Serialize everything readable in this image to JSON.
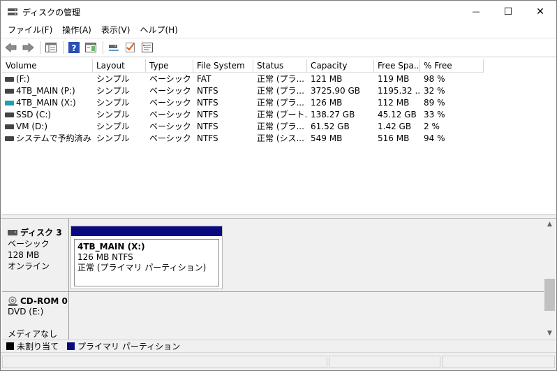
{
  "window": {
    "title": "ディスクの管理",
    "minimize_glyph": "—",
    "maximize_glyph": "☐",
    "close_glyph": "✕"
  },
  "menu": [
    "ファイル(F)",
    "操作(A)",
    "表示(V)",
    "ヘルプ(H)"
  ],
  "toolbar": {
    "icons": [
      "back-arrow-icon",
      "forward-arrow-icon",
      "list-view-icon",
      "help-icon",
      "properties-pane-icon",
      "connect-icon",
      "check-icon",
      "settings-pane-icon"
    ]
  },
  "volumes": {
    "columns": [
      "Volume",
      "Layout",
      "Type",
      "File System",
      "Status",
      "Capacity",
      "Free Spa...",
      "% Free"
    ],
    "rows": [
      {
        "volume": "(F:)",
        "layout": "シンプル",
        "type": "ベーシック",
        "fs": "FAT",
        "status": "正常 (プラ...",
        "capacity": "121 MB",
        "free": "119 MB",
        "pct": "98 %",
        "icon_color": "#444444"
      },
      {
        "volume": "4TB_MAIN (P:)",
        "layout": "シンプル",
        "type": "ベーシック",
        "fs": "NTFS",
        "status": "正常 (プラ...",
        "capacity": "3725.90 GB",
        "free": "1195.32 ...",
        "pct": "32 %",
        "icon_color": "#444444"
      },
      {
        "volume": "4TB_MAIN (X:)",
        "layout": "シンプル",
        "type": "ベーシック",
        "fs": "NTFS",
        "status": "正常 (プラ...",
        "capacity": "126 MB",
        "free": "112 MB",
        "pct": "89 %",
        "icon_color": "#1e9fb0"
      },
      {
        "volume": "SSD (C:)",
        "layout": "シンプル",
        "type": "ベーシック",
        "fs": "NTFS",
        "status": "正常 (ブート...",
        "capacity": "138.27 GB",
        "free": "45.12 GB",
        "pct": "33 %",
        "icon_color": "#444444"
      },
      {
        "volume": "VM (D:)",
        "layout": "シンプル",
        "type": "ベーシック",
        "fs": "NTFS",
        "status": "正常 (プラ...",
        "capacity": "61.52 GB",
        "free": "1.42 GB",
        "pct": "2 %",
        "icon_color": "#444444"
      },
      {
        "volume": "システムで予約済み",
        "layout": "シンプル",
        "type": "ベーシック",
        "fs": "NTFS",
        "status": "正常 (シス...",
        "capacity": "549 MB",
        "free": "516 MB",
        "pct": "94 %",
        "icon_color": "#444444"
      }
    ]
  },
  "disks": [
    {
      "name": "ディスク 3",
      "lines": [
        "ベーシック",
        "128 MB",
        "オンライン"
      ],
      "partition": {
        "title": "4TB_MAIN  (X:)",
        "size_fs": "126 MB NTFS",
        "status": "正常 (プライマリ パーティション)",
        "bar_color": "#0a0a80"
      }
    },
    {
      "name": "CD-ROM 0",
      "lines": [
        "DVD (E:)",
        "",
        "メディアなし"
      ]
    }
  ],
  "legend": [
    {
      "label": "未割り当て",
      "color": "#000000"
    },
    {
      "label": "プライマリ パーティション",
      "color": "#0a0a80"
    }
  ]
}
